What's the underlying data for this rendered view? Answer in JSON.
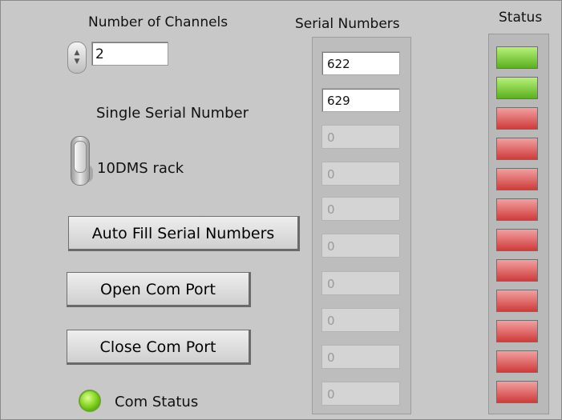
{
  "channels": {
    "label": "Number of Channels",
    "value": "2",
    "spin_up": "▲",
    "spin_down": "▼"
  },
  "single_serial": {
    "label": "Single Serial Number"
  },
  "rack_toggle": {
    "label": "10DMS rack"
  },
  "buttons": {
    "auto_fill": "Auto Fill Serial Numbers",
    "open_port": "Open Com Port",
    "close_port": "Close Com Port"
  },
  "com_status": {
    "label": "Com Status",
    "state": "on",
    "color": "#6fc51b"
  },
  "serials": {
    "header": "Serial Numbers",
    "values": [
      "622",
      "629",
      "0",
      "0",
      "0",
      "0",
      "0",
      "0",
      "0",
      "0"
    ],
    "active_count": 2
  },
  "status": {
    "header": "Status",
    "states": [
      "green",
      "green",
      "red",
      "red",
      "red",
      "red",
      "red",
      "red",
      "red",
      "red",
      "red",
      "red"
    ],
    "colors": {
      "green": "#6fc51b",
      "red": "#d94848"
    }
  }
}
